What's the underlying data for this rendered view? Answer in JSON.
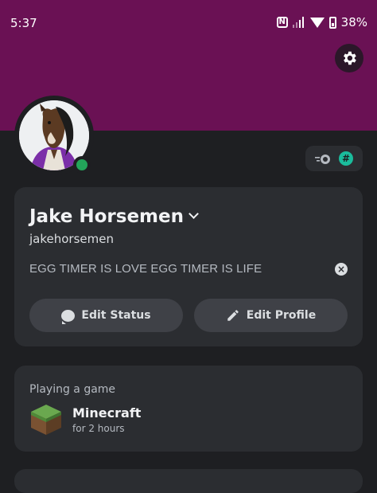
{
  "status_bar": {
    "time": "5:37",
    "battery": "38%",
    "icons": [
      "nfc-icon",
      "signal-icon",
      "wifi-icon",
      "battery-icon"
    ]
  },
  "colors": {
    "banner": "#6a1154",
    "background": "#1e1f22",
    "card": "#2b2d31",
    "button": "#3f4147",
    "online": "#23a55a",
    "hash_badge": "#1abc9c"
  },
  "profile": {
    "display_name": "Jake Horsemen",
    "username": "jakehorsemen",
    "custom_status": "EGG TIMER IS LOVE EGG TIMER IS LIFE",
    "presence": "online"
  },
  "buttons": {
    "edit_status": "Edit Status",
    "edit_profile": "Edit Profile"
  },
  "activity": {
    "title": "Playing a game",
    "game": "Minecraft",
    "duration": "for 2 hours"
  }
}
